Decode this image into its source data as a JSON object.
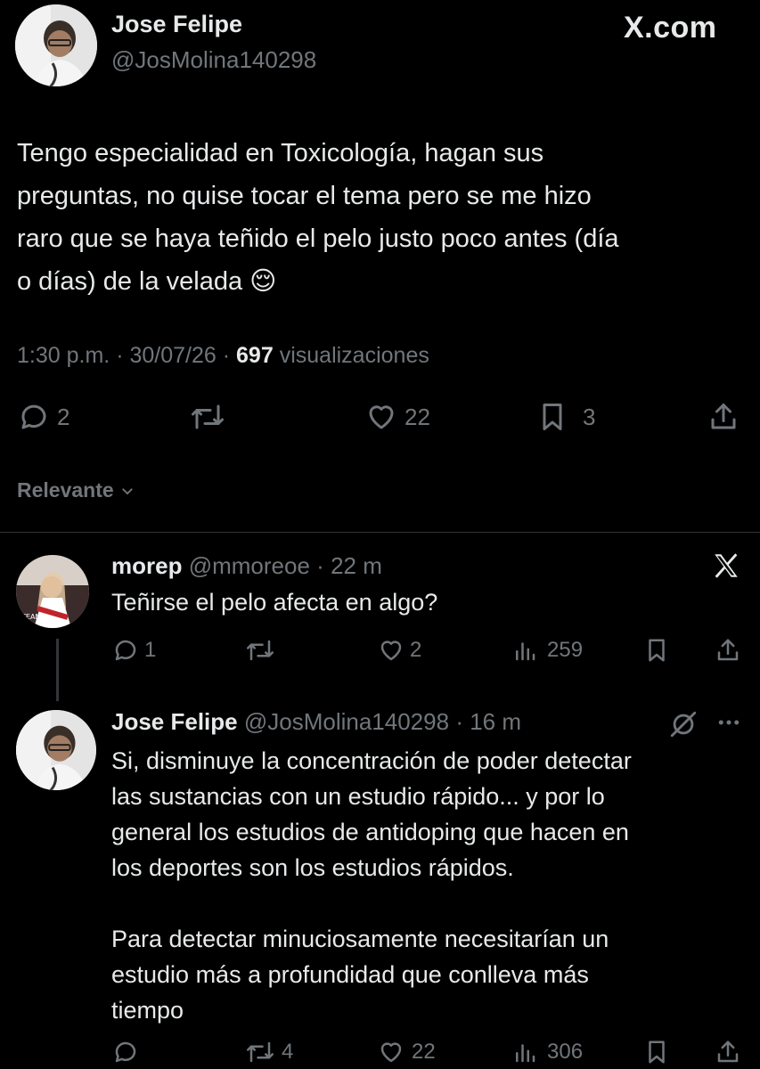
{
  "header": {
    "display_name": "Jose Felipe",
    "handle": "@JosMolina140298",
    "brand": "X.com"
  },
  "tweet": {
    "text_lines": [
      "Tengo especialidad en Toxicología, hagan sus",
      "preguntas, no quise tocar el tema pero se me hizo",
      "raro que se haya teñido el pelo justo poco antes (día",
      "o días) de la velada 😌"
    ],
    "time": "1:30 p.m.",
    "date": "30/07/26",
    "sep": "·",
    "views_count": "697",
    "views_label": "visualizaciones",
    "replies": "2",
    "likes": "22",
    "bookmarks": "3"
  },
  "sort": {
    "label": "Relevante"
  },
  "reply1": {
    "display_name": "morep",
    "handle": "@mmoreoe",
    "sep": "·",
    "time": "22 m",
    "text": "Teñirse el pelo afecta en algo?",
    "replies": "1",
    "likes": "2",
    "views": "259"
  },
  "reply2": {
    "display_name": "Jose Felipe",
    "handle": "@JosMolina140298",
    "sep": "·",
    "time": "16 m",
    "text_lines_p1": [
      "Si, disminuye la concentración de poder detectar",
      "las sustancias con un estudio rápido... y por lo",
      "general los estudios de antidoping que hacen en",
      "los deportes son los estudios rápidos."
    ],
    "text_lines_p2": [
      "Para detectar minuciosamente necesitarían un",
      "estudio más a profundidad que conlleva más",
      "tiempo"
    ],
    "retweets": "4",
    "likes": "22",
    "views": "306"
  },
  "icons": {
    "reply": "reply-icon",
    "retweet": "retweet-icon",
    "like": "heart-icon",
    "bookmark": "bookmark-icon",
    "share": "share-icon",
    "views": "views-icon",
    "x_logo": "x-logo-icon",
    "grok": "grok-icon",
    "more": "more-icon",
    "chevron": "chevron-down-icon"
  }
}
